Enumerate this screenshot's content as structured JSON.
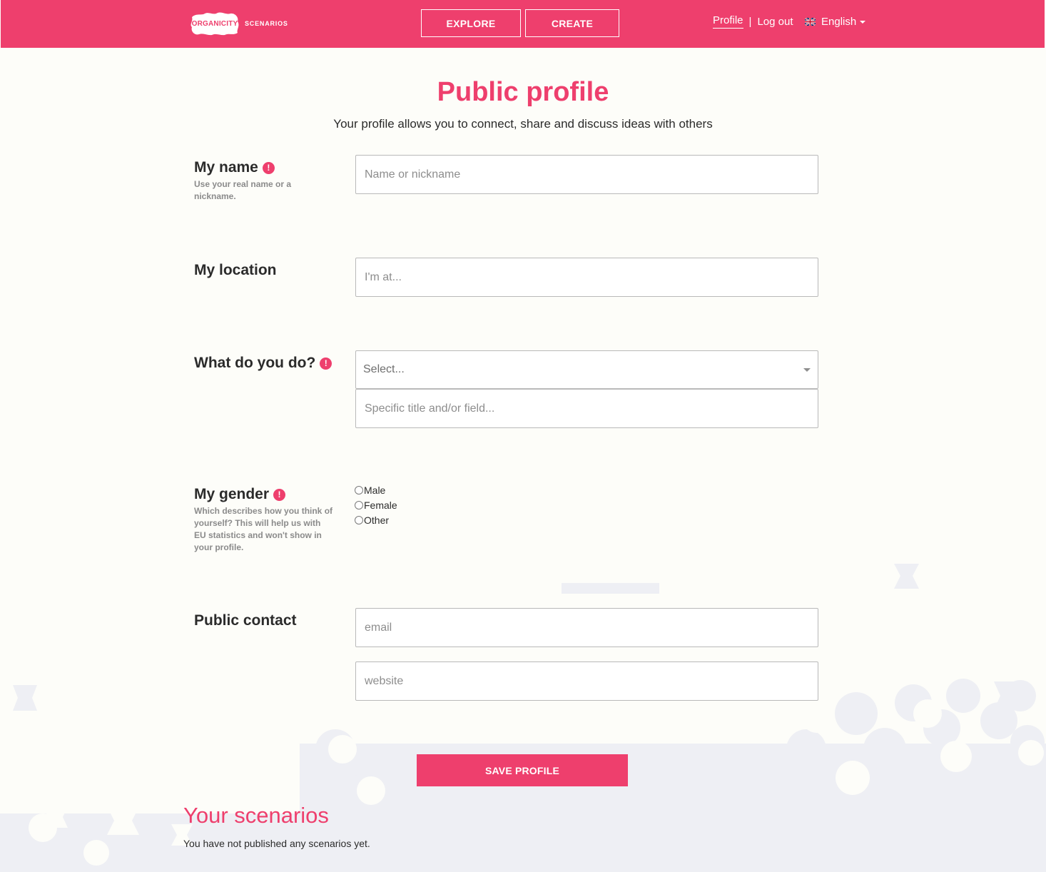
{
  "header": {
    "logo_text": "ORGANICITY",
    "logo_subtext": "SCENARIOS",
    "nav": {
      "explore_label": "EXPLORE",
      "create_label": "CREATE"
    },
    "user": {
      "profile_label": "Profile",
      "separator": "|",
      "logout_label": "Log out"
    },
    "language": {
      "label": "English",
      "flag_icon": "uk-flag-icon"
    }
  },
  "page": {
    "title": "Public profile",
    "subtitle": "Your profile allows you to connect, share and discuss ideas with others"
  },
  "form": {
    "name": {
      "label": "My name",
      "required_icon": "!",
      "hint": "Use your real name or a nickname.",
      "placeholder": "Name or nickname",
      "value": ""
    },
    "location": {
      "label": "My location",
      "placeholder": "I'm at...",
      "value": ""
    },
    "occupation": {
      "label": "What do you do?",
      "required_icon": "!",
      "select_value": "Select...",
      "title_placeholder": "Specific title and/or field...",
      "title_value": ""
    },
    "gender": {
      "label": "My gender",
      "required_icon": "!",
      "hint": "Which describes how you think of yourself? This will help us with EU statistics and won't show in your profile.",
      "options": [
        "Male",
        "Female",
        "Other"
      ]
    },
    "contact": {
      "label": "Public contact",
      "email_placeholder": "email",
      "website_placeholder": "website"
    },
    "save_label": "SAVE PROFILE"
  },
  "scenarios": {
    "title": "Your scenarios",
    "empty_text": "You have not published any scenarios yet."
  },
  "colors": {
    "brand": "#ee3f6d",
    "background": "#fdfdf9",
    "deco": "#eeeff4"
  }
}
